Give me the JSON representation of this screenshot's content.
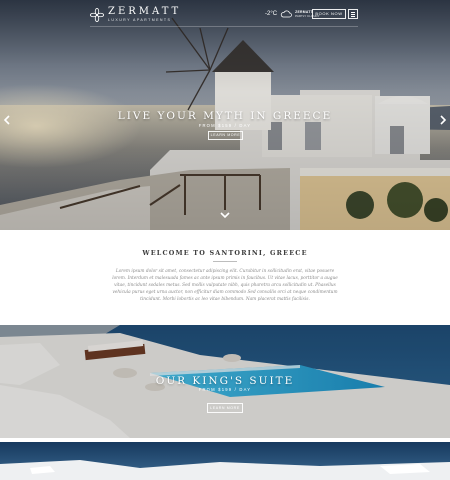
{
  "header": {
    "brand_name": "ZERMATT",
    "brand_tagline": "LUXURY APARTMENTS",
    "weather_temp": "-2°C",
    "weather_place": "ZERMATT",
    "weather_condition": "PARTLY CLOUDY",
    "book_label": "BOOK NOW",
    "icons": {
      "logo": "flower-logo-icon",
      "weather": "cloud-icon",
      "menu": "menu-icon"
    }
  },
  "hero": {
    "title": "LIVE YOUR MYTH IN GREECE",
    "subtitle": "FROM $159 / DAY",
    "button_label": "LEARN MORE",
    "icons": {
      "prev": "chevron-left-icon",
      "next": "chevron-right-icon",
      "down": "chevron-down-icon"
    }
  },
  "welcome": {
    "title": "WELCOME TO SANTORINI, GREECE",
    "body": "Lorem ipsum dolor sit amet, consectetur adipiscing elit. Curabitur in sollicitudin erat, vitae posuere lorem. Interdum et malesuada fames ac ante ipsum primis in faucibus. Ut vitae lacus, porttitor a augue vitae, tincidunt sodales metus. Sed mollis vulputate nibh, quis pharetra arcu sollicitudin ut. Phasellus vehicula purus eget urna auctor, non efficitur diam commodo Sed convallis orci at neque condimentum tincidunt. Morbi lobortis ac leo vitae bibendum. Nam placerat mattis facilisis."
  },
  "suite": {
    "title": "OUR KING'S SUITE",
    "subtitle": "FROM $199 / DAY",
    "button_label": "LEARN MORE"
  },
  "colors": {
    "accent": "#ffffff",
    "text_dark": "#3a3a3a",
    "text_muted": "#8a8a8a",
    "sea": "#2f5f86",
    "pool": "#27a8d6"
  }
}
